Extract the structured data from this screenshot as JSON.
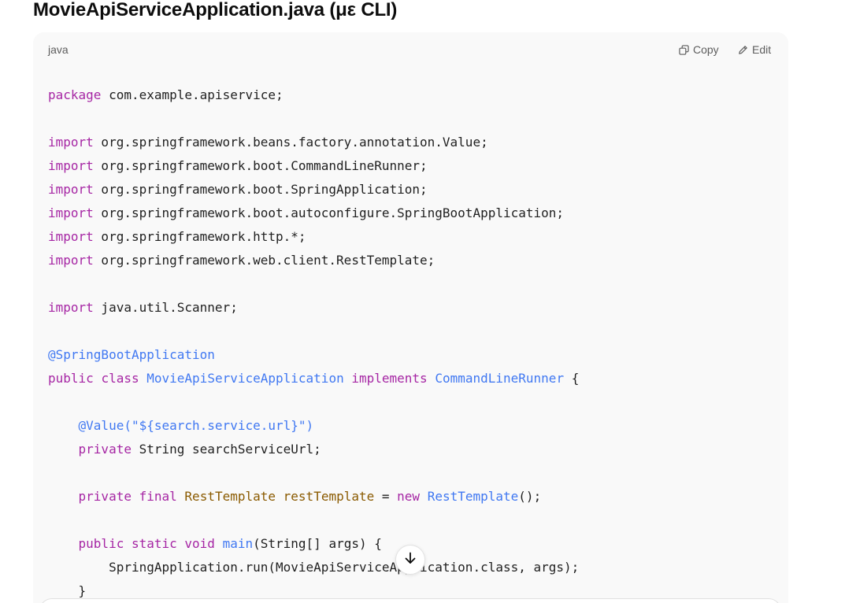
{
  "heading": "MovieApiServiceApplication.java (με CLI)",
  "code_block": {
    "language": "java",
    "copy_label": "Copy",
    "edit_label": "Edit",
    "lines": [
      [
        [
          "kw",
          "package"
        ],
        [
          "t",
          " com.example.apiservice;"
        ]
      ],
      [],
      [
        [
          "kw",
          "import"
        ],
        [
          "t",
          " org.springframework.beans.factory.annotation.Value;"
        ]
      ],
      [
        [
          "kw",
          "import"
        ],
        [
          "t",
          " org.springframework.boot.CommandLineRunner;"
        ]
      ],
      [
        [
          "kw",
          "import"
        ],
        [
          "t",
          " org.springframework.boot.SpringApplication;"
        ]
      ],
      [
        [
          "kw",
          "import"
        ],
        [
          "t",
          " org.springframework.boot.autoconfigure.SpringBootApplication;"
        ]
      ],
      [
        [
          "kw",
          "import"
        ],
        [
          "t",
          " org.springframework.http.*;"
        ]
      ],
      [
        [
          "kw",
          "import"
        ],
        [
          "t",
          " org.springframework.web.client.RestTemplate;"
        ]
      ],
      [],
      [
        [
          "kw",
          "import"
        ],
        [
          "t",
          " java.util.Scanner;"
        ]
      ],
      [],
      [
        [
          "ann",
          "@SpringBootApplication"
        ]
      ],
      [
        [
          "kw",
          "public"
        ],
        [
          "t",
          " "
        ],
        [
          "kw",
          "class"
        ],
        [
          "t",
          " "
        ],
        [
          "cls",
          "MovieApiServiceApplication"
        ],
        [
          "t",
          " "
        ],
        [
          "kw",
          "implements"
        ],
        [
          "t",
          " "
        ],
        [
          "cls",
          "CommandLineRunner"
        ],
        [
          "t",
          " {"
        ]
      ],
      [],
      [
        [
          "t",
          "    "
        ],
        [
          "ann",
          "@Value"
        ],
        [
          "str",
          "(\"${search.service.url}\")"
        ]
      ],
      [
        [
          "t",
          "    "
        ],
        [
          "kw",
          "private"
        ],
        [
          "t",
          " String searchServiceUrl;"
        ]
      ],
      [],
      [
        [
          "t",
          "    "
        ],
        [
          "kw",
          "private"
        ],
        [
          "t",
          " "
        ],
        [
          "kw",
          "final"
        ],
        [
          "t",
          " "
        ],
        [
          "typ",
          "RestTemplate"
        ],
        [
          "t",
          " "
        ],
        [
          "var",
          "restTemplate"
        ],
        [
          "t",
          " = "
        ],
        [
          "kw",
          "new"
        ],
        [
          "t",
          " "
        ],
        [
          "fn",
          "RestTemplate"
        ],
        [
          "t",
          "();"
        ]
      ],
      [],
      [
        [
          "t",
          "    "
        ],
        [
          "kw",
          "public"
        ],
        [
          "t",
          " "
        ],
        [
          "kw",
          "static"
        ],
        [
          "t",
          " "
        ],
        [
          "kw",
          "void"
        ],
        [
          "t",
          " "
        ],
        [
          "fn",
          "main"
        ],
        [
          "t",
          "(String[] args) {"
        ]
      ],
      [
        [
          "t",
          "        SpringApplication.run(MovieApiServiceApplication.class, args);"
        ]
      ],
      [
        [
          "t",
          "    }"
        ]
      ]
    ]
  },
  "icons": {
    "copy": "copy-icon",
    "edit": "pencil-icon",
    "scroll": "arrow-down-icon"
  },
  "colors": {
    "keyword": "#a626a4",
    "class_name": "#4078f2",
    "type_name": "#8a5a00",
    "code_background": "#f9f9f9"
  }
}
